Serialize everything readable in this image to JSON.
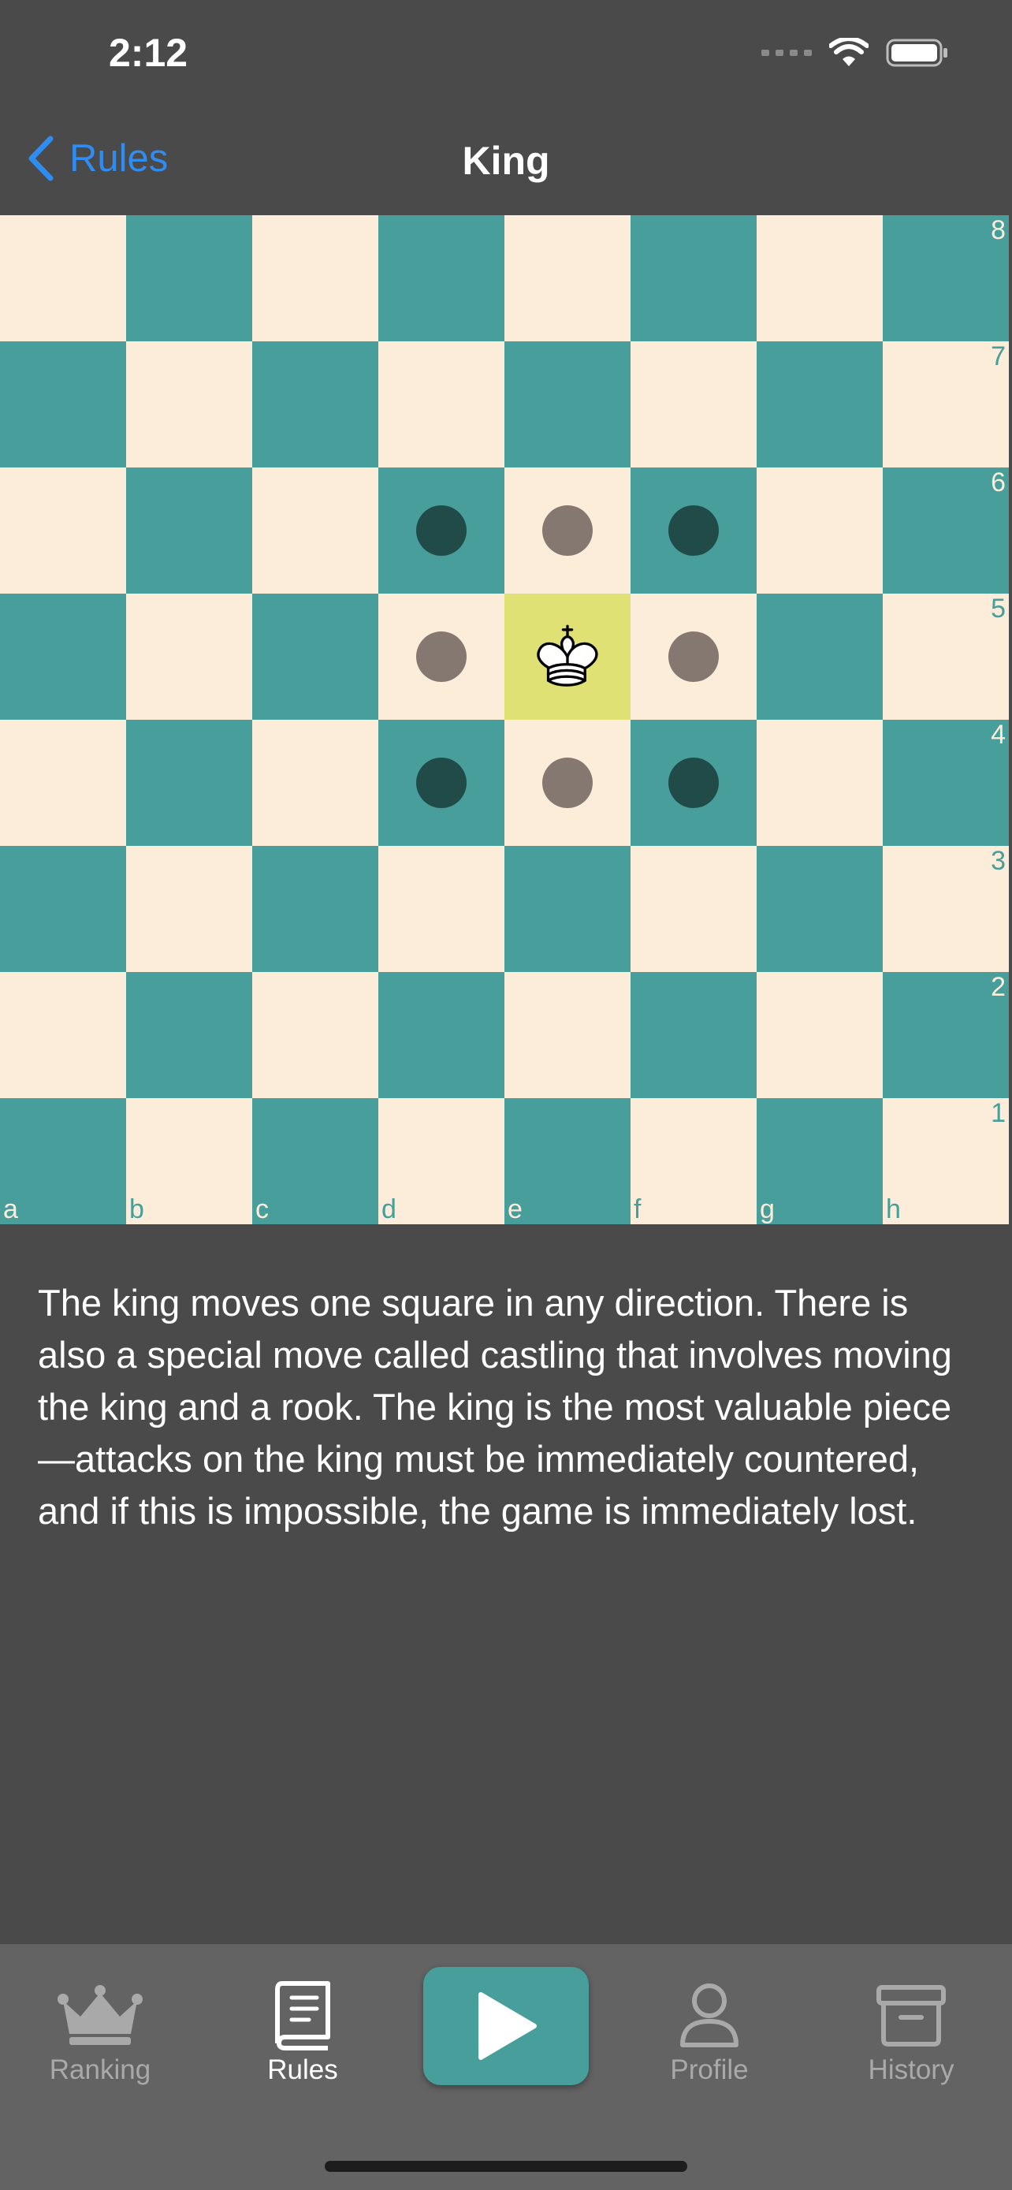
{
  "status_bar": {
    "time": "2:12",
    "icons": [
      "cellular-signal-icon",
      "wifi-icon",
      "battery-icon"
    ]
  },
  "nav": {
    "back_label": "Rules",
    "title": "King"
  },
  "board": {
    "files": [
      "a",
      "b",
      "c",
      "d",
      "e",
      "f",
      "g",
      "h"
    ],
    "ranks": [
      "8",
      "7",
      "6",
      "5",
      "4",
      "3",
      "2",
      "1"
    ],
    "piece": {
      "name": "king",
      "color": "white",
      "square": "e5"
    },
    "highlighted_square": "e5",
    "move_dots": [
      "d6",
      "e6",
      "f6",
      "d5",
      "f5",
      "d4",
      "e4",
      "f4"
    ],
    "colors": {
      "light": "#fcecda",
      "dark": "#479e9a",
      "highlight": "#dfe174",
      "dot_on_light": "#857870",
      "dot_on_dark": "#214b48"
    }
  },
  "description": "The king moves one square in any direction. There is also a special move called castling that involves moving the king and a rook. The king is the most valuable piece—attacks on the king must be immediately countered, and if this is impossible, the game is immediately lost.",
  "tab_bar": {
    "tabs": [
      {
        "label": "Ranking",
        "icon": "crown-icon",
        "active": false
      },
      {
        "label": "Rules",
        "icon": "book-icon",
        "active": true
      },
      {
        "label": "Profile",
        "icon": "person-icon",
        "active": false
      },
      {
        "label": "History",
        "icon": "archive-box-icon",
        "active": false
      }
    ],
    "play_icon": "play-icon",
    "accent": "#479e9a"
  }
}
